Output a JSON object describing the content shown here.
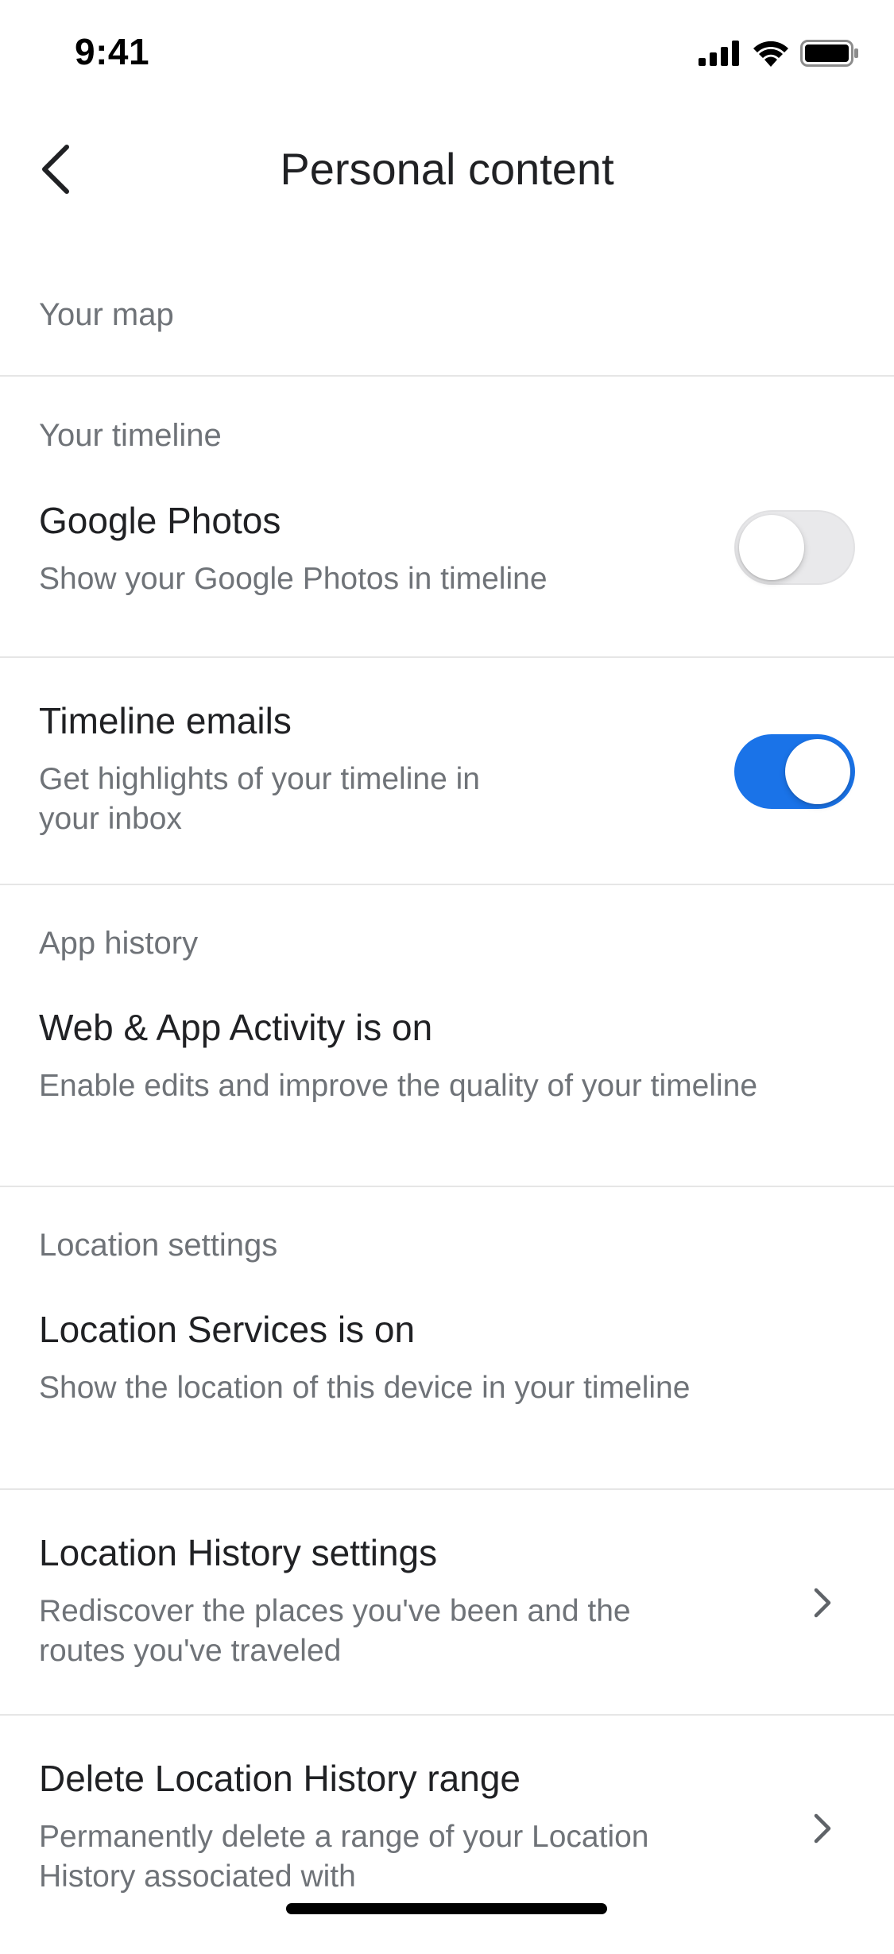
{
  "status_bar": {
    "time": "9:41",
    "icons": [
      "cellular-signal-icon",
      "wifi-icon",
      "battery-icon"
    ]
  },
  "app_bar": {
    "back_icon": "chevron-left-icon",
    "title": "Personal content"
  },
  "sections": {
    "your_map": "Your map",
    "your_timeline": "Your timeline",
    "app_history": "App history",
    "location_settings": "Location settings"
  },
  "rows": {
    "google_photos": {
      "title": "Google Photos",
      "subtitle": "Show your Google Photos in timeline",
      "toggle_on": false
    },
    "timeline_emails": {
      "title": "Timeline emails",
      "subtitle_line1": "Get highlights of your timeline in",
      "subtitle_line2": "your inbox",
      "toggle_on": true
    },
    "web_app_activity": {
      "title": "Web & App Activity is on",
      "subtitle": "Enable edits and improve the quality of your timeline"
    },
    "location_services": {
      "title": "Location Services is on",
      "subtitle": "Show the location of this device in your timeline"
    },
    "location_history_settings": {
      "title": "Location History settings",
      "subtitle_line1": "Rediscover the places you've been and the",
      "subtitle_line2": "routes you've traveled",
      "icon": "chevron-right-icon"
    },
    "delete_location_history": {
      "title": "Delete Location History range",
      "subtitle_line1": "Permanently delete a range of your Location",
      "subtitle_line2": "History associated with",
      "icon": "chevron-right-icon"
    }
  },
  "colors": {
    "accent": "#1a73e8",
    "primary_text": "#202124",
    "secondary_text": "#6f7378",
    "divider": "#e6e6e6"
  }
}
